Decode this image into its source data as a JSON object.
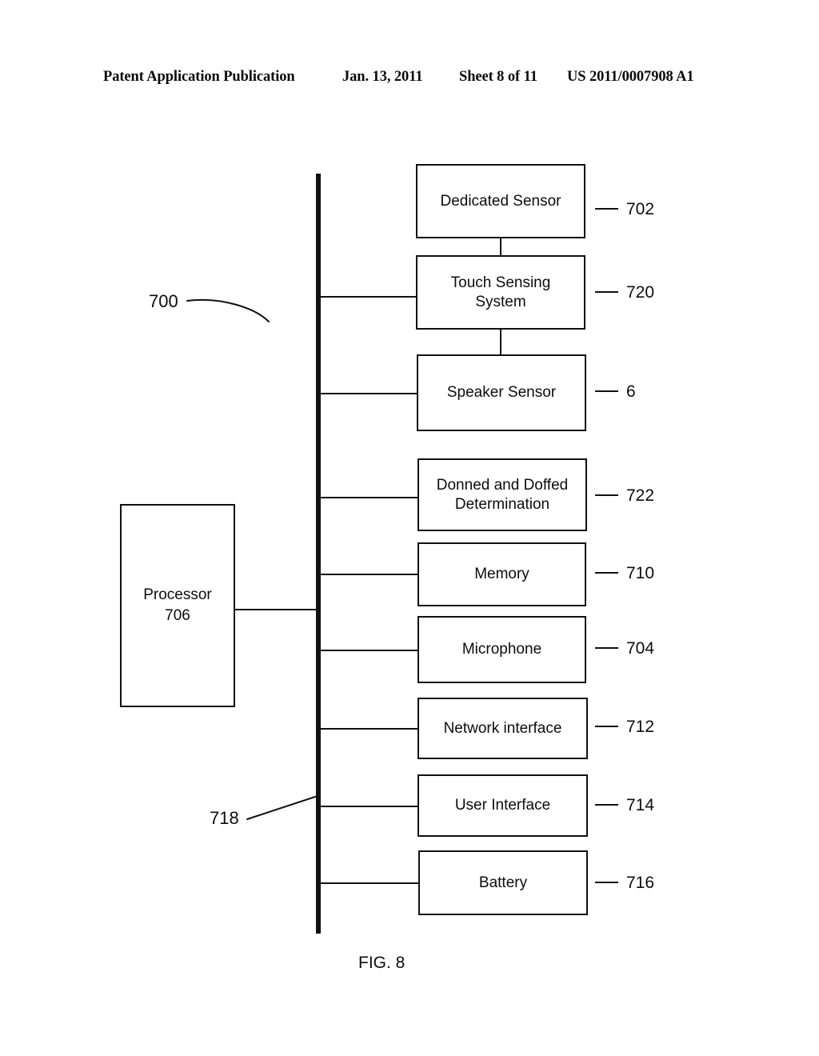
{
  "header": {
    "publication": "Patent Application Publication",
    "date": "Jan. 13, 2011",
    "sheet": "Sheet 8 of 11",
    "patent_number": "US 2011/0007908 A1"
  },
  "figure": {
    "caption": "FIG. 8",
    "system_label": "700",
    "bus_label": "718",
    "processor": {
      "label": "Processor\n706",
      "name": "Processor",
      "ref": "706"
    },
    "blocks": [
      {
        "name": "dedicated-sensor",
        "label": "Dedicated Sensor",
        "ref": "702",
        "connects_to_bus": false
      },
      {
        "name": "touch-sensing",
        "label": "Touch Sensing\nSystem",
        "ref": "720",
        "connects_to_bus": true
      },
      {
        "name": "speaker-sensor",
        "label": "Speaker Sensor",
        "ref": "6",
        "connects_to_bus": true
      },
      {
        "name": "donned-doffed",
        "label": "Donned and Doffed\nDetermination",
        "ref": "722",
        "connects_to_bus": true
      },
      {
        "name": "memory",
        "label": "Memory",
        "ref": "710",
        "connects_to_bus": true
      },
      {
        "name": "microphone",
        "label": "Microphone",
        "ref": "704",
        "connects_to_bus": true
      },
      {
        "name": "network-interface",
        "label": "Network interface",
        "ref": "712",
        "connects_to_bus": true
      },
      {
        "name": "user-interface",
        "label": "User Interface",
        "ref": "714",
        "connects_to_bus": true
      },
      {
        "name": "battery",
        "label": "Battery",
        "ref": "716",
        "connects_to_bus": true
      }
    ],
    "colors": {
      "ink": "#111111",
      "paper": "#ffffff"
    }
  }
}
